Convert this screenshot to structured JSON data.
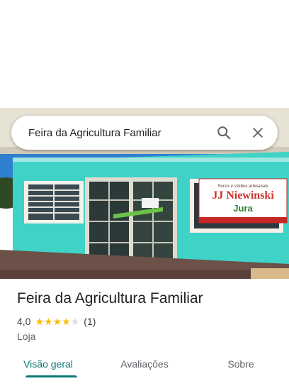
{
  "search": {
    "query": "Feira da Agricultura Familiar",
    "search_icon": "search-icon",
    "close_icon": "close-icon"
  },
  "photo": {
    "sign_top": "Sucos e vinhos artesanais",
    "sign_name": "JJ Niewinski",
    "sign_brand": "Jura"
  },
  "place": {
    "title": "Feira da Agricultura Familiar",
    "rating": "4,0",
    "stars": 4,
    "review_count": "(1)",
    "category": "Loja"
  },
  "tabs": [
    {
      "label": "Visão geral",
      "active": true
    },
    {
      "label": "Avaliações",
      "active": false
    },
    {
      "label": "Sobre",
      "active": false
    }
  ],
  "colors": {
    "accent": "#0b7a75",
    "star": "#fbbc04",
    "wall": "#3fd2c7"
  }
}
